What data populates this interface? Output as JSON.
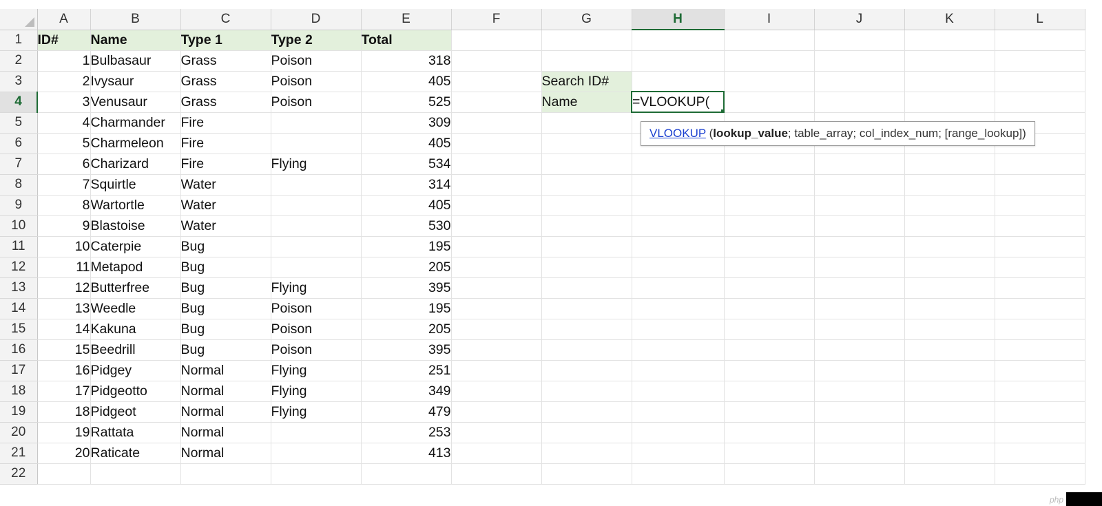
{
  "columns": [
    "A",
    "B",
    "C",
    "D",
    "E",
    "F",
    "G",
    "H",
    "I",
    "J",
    "K",
    "L"
  ],
  "active_column": "H",
  "active_row": 4,
  "headers": {
    "id": "ID#",
    "name": "Name",
    "type1": "Type 1",
    "type2": "Type 2",
    "total": "Total"
  },
  "rows": [
    {
      "id": "1",
      "name": "Bulbasaur",
      "type1": "Grass",
      "type2": "Poison",
      "total": "318"
    },
    {
      "id": "2",
      "name": "Ivysaur",
      "type1": "Grass",
      "type2": "Poison",
      "total": "405"
    },
    {
      "id": "3",
      "name": "Venusaur",
      "type1": "Grass",
      "type2": "Poison",
      "total": "525"
    },
    {
      "id": "4",
      "name": "Charmander",
      "type1": "Fire",
      "type2": "",
      "total": "309"
    },
    {
      "id": "5",
      "name": "Charmeleon",
      "type1": "Fire",
      "type2": "",
      "total": "405"
    },
    {
      "id": "6",
      "name": "Charizard",
      "type1": "Fire",
      "type2": "Flying",
      "total": "534"
    },
    {
      "id": "7",
      "name": "Squirtle",
      "type1": "Water",
      "type2": "",
      "total": "314"
    },
    {
      "id": "8",
      "name": "Wartortle",
      "type1": "Water",
      "type2": "",
      "total": "405"
    },
    {
      "id": "9",
      "name": "Blastoise",
      "type1": "Water",
      "type2": "",
      "total": "530"
    },
    {
      "id": "10",
      "name": "Caterpie",
      "type1": "Bug",
      "type2": "",
      "total": "195"
    },
    {
      "id": "11",
      "name": "Metapod",
      "type1": "Bug",
      "type2": "",
      "total": "205"
    },
    {
      "id": "12",
      "name": "Butterfree",
      "type1": "Bug",
      "type2": "Flying",
      "total": "395"
    },
    {
      "id": "13",
      "name": "Weedle",
      "type1": "Bug",
      "type2": "Poison",
      "total": "195"
    },
    {
      "id": "14",
      "name": "Kakuna",
      "type1": "Bug",
      "type2": "Poison",
      "total": "205"
    },
    {
      "id": "15",
      "name": "Beedrill",
      "type1": "Bug",
      "type2": "Poison",
      "total": "395"
    },
    {
      "id": "16",
      "name": "Pidgey",
      "type1": "Normal",
      "type2": "Flying",
      "total": "251"
    },
    {
      "id": "17",
      "name": "Pidgeotto",
      "type1": "Normal",
      "type2": "Flying",
      "total": "349"
    },
    {
      "id": "18",
      "name": "Pidgeot",
      "type1": "Normal",
      "type2": "Flying",
      "total": "479"
    },
    {
      "id": "19",
      "name": "Rattata",
      "type1": "Normal",
      "type2": "",
      "total": "253"
    },
    {
      "id": "20",
      "name": "Raticate",
      "type1": "Normal",
      "type2": "",
      "total": "413"
    }
  ],
  "search": {
    "label": "Search ID#",
    "name_label": "Name",
    "formula": "=VLOOKUP("
  },
  "tooltip": {
    "function": "VLOOKUP",
    "open": " (",
    "arg1": "lookup_value",
    "rest": "; table_array; col_index_num; [range_lookup])"
  },
  "watermark": "php"
}
